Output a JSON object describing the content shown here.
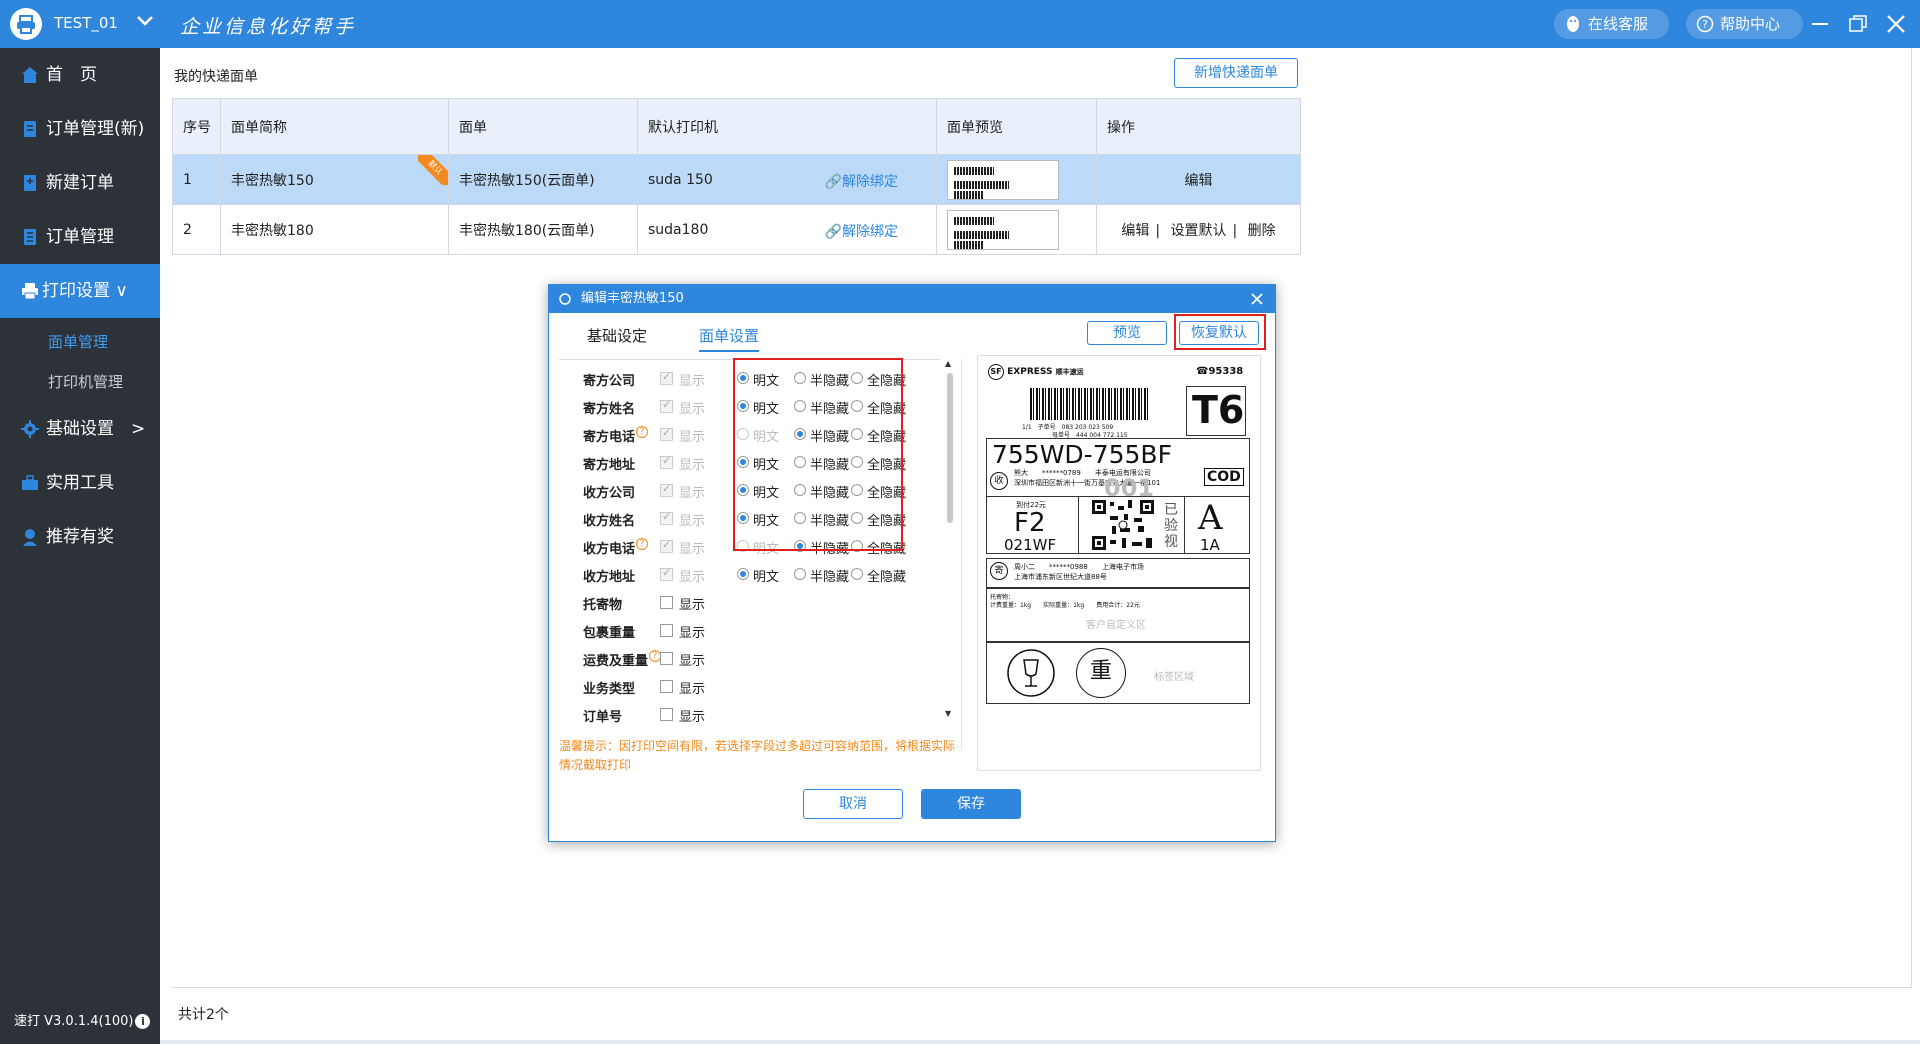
{
  "app": {
    "account": "TEST_01",
    "slogan": "企业信息化好帮手",
    "service": "在线客服",
    "help": "帮助中心",
    "version": "速打 V3.0.1.4(100)"
  },
  "sidebar": {
    "items": [
      {
        "label": "首　页"
      },
      {
        "label": "订单管理(新)"
      },
      {
        "label": "新建订单"
      },
      {
        "label": "订单管理"
      },
      {
        "label": "打印设置 ∨"
      },
      {
        "label": "基础设置　>"
      },
      {
        "label": "实用工具"
      },
      {
        "label": "推荐有奖"
      }
    ],
    "sub": [
      {
        "label": "面单管理"
      },
      {
        "label": "打印机管理"
      }
    ]
  },
  "main": {
    "title": "我的快递面单",
    "add_button": "新增快递面单",
    "total": "共计2个",
    "columns": [
      "序号",
      "面单简称",
      "面单",
      "默认打印机",
      "面单预览",
      "操作"
    ],
    "rows": [
      {
        "no": "1",
        "short": "丰密热敏150",
        "sheet": "丰密热敏150(云面单)",
        "printer": "suda 150",
        "unbind": "解除绑定",
        "badge": "默认",
        "ops": [
          "编辑"
        ]
      },
      {
        "no": "2",
        "short": "丰密热敏180",
        "sheet": "丰密热敏180(云面单)",
        "printer": "suda180",
        "unbind": "解除绑定",
        "ops": [
          "编辑",
          "设置默认",
          "删除"
        ]
      }
    ]
  },
  "dialog": {
    "title": "编辑丰密热敏150",
    "tabs": [
      "基础设定",
      "面单设置"
    ],
    "preview_button": "预览",
    "restore_button": "恢复默认",
    "show_label": "显示",
    "options": [
      "明文",
      "半隐藏",
      "全隐藏"
    ],
    "fields": [
      {
        "name": "寄方公司",
        "help": false,
        "show_checked": true,
        "show_disabled": true,
        "mode": 0,
        "mode_disabled": false
      },
      {
        "name": "寄方姓名",
        "help": false,
        "show_checked": true,
        "show_disabled": true,
        "mode": 0,
        "mode_disabled": false
      },
      {
        "name": "寄方电话",
        "help": true,
        "show_checked": true,
        "show_disabled": true,
        "mode": 1,
        "mode_disabled": true
      },
      {
        "name": "寄方地址",
        "help": false,
        "show_checked": true,
        "show_disabled": true,
        "mode": 0,
        "mode_disabled": false
      },
      {
        "name": "收方公司",
        "help": false,
        "show_checked": true,
        "show_disabled": true,
        "mode": 0,
        "mode_disabled": false
      },
      {
        "name": "收方姓名",
        "help": false,
        "show_checked": true,
        "show_disabled": true,
        "mode": 0,
        "mode_disabled": false
      },
      {
        "name": "收方电话",
        "help": true,
        "show_checked": true,
        "show_disabled": true,
        "mode": 1,
        "mode_disabled": true
      },
      {
        "name": "收方地址",
        "help": false,
        "show_checked": true,
        "show_disabled": true,
        "mode": 0,
        "mode_disabled": false
      },
      {
        "name": "托寄物",
        "help": false,
        "show_checked": false,
        "show_disabled": false,
        "mode": null
      },
      {
        "name": "包裹重量",
        "help": false,
        "show_checked": false,
        "show_disabled": false,
        "mode": null
      },
      {
        "name": "运费及重量",
        "help": true,
        "show_checked": false,
        "show_disabled": false,
        "mode": null
      },
      {
        "name": "业务类型",
        "help": false,
        "show_checked": false,
        "show_disabled": false,
        "mode": null
      },
      {
        "name": "订单号",
        "help": false,
        "show_checked": false,
        "show_disabled": false,
        "mode": null
      }
    ],
    "tips": "温馨提示：因打印空间有限，若选择字段过多超过可容纳范围，将根据实际情况截取打印",
    "cancel": "取消",
    "save": "保存"
  },
  "waybill": {
    "brand": "EXPRESS",
    "brand_cn": "顺丰速运",
    "hotline": "95338",
    "route_code": "T6",
    "dest_code": "755WD-755BF",
    "cod": "COD",
    "recv_tag": "收",
    "send_tag": "寄",
    "big_no": "001",
    "f2": "F2",
    "code2": "021WF",
    "verified": "已验视",
    "pro_letter": "A",
    "pro_code": "1A",
    "receiver": "熊大　　******0789　　丰泰电运有限公司",
    "receiver_addr": "深圳市福田区新洲十一街万基商务大厦一楼101",
    "sender": "周小二　　******0988　　上海电子市场",
    "sender_addr": "上海市浦东新区世纪大道88号",
    "cargo": "托寄物：",
    "weights": "计费重量：1kg　　实际重量：1kg　　费用合计：22元",
    "custom": "客户自定义区",
    "heavy": "重",
    "label_area": "标签区域",
    "fee": "到付22元",
    "waybill_no": "1/1　子单号　083 203 023 509",
    "parent_no": "母单号　444 004 772 115"
  },
  "colors": {
    "primary": "#2f86dd",
    "sidebar": "#2d3138",
    "selected_row": "#bcdaf8",
    "warning": "#f28a1f",
    "highlight": "#e02020"
  }
}
